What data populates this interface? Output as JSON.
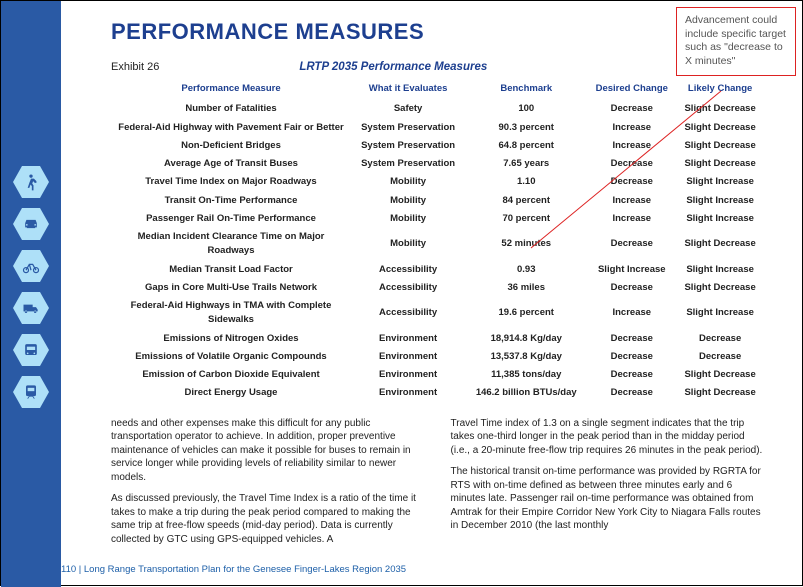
{
  "page_title": "PERFORMANCE MEASURES",
  "exhibit_label": "Exhibit 26",
  "exhibit_title": "LRTP 2035 Performance Measures",
  "columns": {
    "c0": "Performance Measure",
    "c1": "What it Evaluates",
    "c2": "Benchmark",
    "c3": "Desired Change",
    "c4": "Likely Change"
  },
  "rows": [
    {
      "m": "Number of Fatalities",
      "e": "Safety",
      "b": "100",
      "d": "Decrease",
      "l": "Slight Decrease"
    },
    {
      "m": "Federal-Aid Highway with Pavement Fair or Better",
      "e": "System Preservation",
      "b": "90.3 percent",
      "d": "Increase",
      "l": "Slight Decrease"
    },
    {
      "m": "Non-Deficient Bridges",
      "e": "System Preservation",
      "b": "64.8 percent",
      "d": "Increase",
      "l": "Slight Decrease"
    },
    {
      "m": "Average Age of Transit Buses",
      "e": "System Preservation",
      "b": "7.65 years",
      "d": "Decrease",
      "l": "Slight Decrease"
    },
    {
      "m": "Travel Time Index on Major Roadways",
      "e": "Mobility",
      "b": "1.10",
      "d": "Decrease",
      "l": "Slight Increase"
    },
    {
      "m": "Transit On-Time Performance",
      "e": "Mobility",
      "b": "84 percent",
      "d": "Increase",
      "l": "Slight Increase"
    },
    {
      "m": "Passenger Rail On-Time Performance",
      "e": "Mobility",
      "b": "70 percent",
      "d": "Increase",
      "l": "Slight Increase"
    },
    {
      "m": "Median Incident Clearance Time on Major Roadways",
      "e": "Mobility",
      "b": "52 minutes",
      "d": "Decrease",
      "l": "Slight Decrease"
    },
    {
      "m": "Median Transit Load Factor",
      "e": "Accessibility",
      "b": "0.93",
      "d": "Slight Increase",
      "l": "Slight Increase"
    },
    {
      "m": "Gaps in Core Multi-Use Trails Network",
      "e": "Accessibility",
      "b": "36 miles",
      "d": "Decrease",
      "l": "Slight Decrease"
    },
    {
      "m": "Federal-Aid Highways in TMA with Complete Sidewalks",
      "e": "Accessibility",
      "b": "19.6 percent",
      "d": "Increase",
      "l": "Slight Increase"
    },
    {
      "m": "Emissions of Nitrogen Oxides",
      "e": "Environment",
      "b": "18,914.8 Kg/day",
      "d": "Decrease",
      "l": "Decrease"
    },
    {
      "m": "Emissions of Volatile Organic Compounds",
      "e": "Environment",
      "b": "13,537.8 Kg/day",
      "d": "Decrease",
      "l": "Decrease"
    },
    {
      "m": "Emission of Carbon Dioxide Equivalent",
      "e": "Environment",
      "b": "11,385 tons/day",
      "d": "Decrease",
      "l": "Slight Decrease"
    },
    {
      "m": "Direct Energy Usage",
      "e": "Environment",
      "b": "146.2 billion BTUs/day",
      "d": "Decrease",
      "l": "Slight Decrease"
    }
  ],
  "body": {
    "left_p1": "needs and other expenses make this difficult for any public transportation operator to achieve. In addition, proper preventive maintenance of vehicles can make it possible for buses to remain in service longer while providing levels of reliability similar to newer models.",
    "left_p2": "As discussed previously, the Travel Time Index is a ratio of the time it takes to make a trip during the peak period compared to making the same trip at free-flow speeds (mid-day period). Data is currently collected by GTC using GPS-equipped vehicles. A",
    "right_p1": "Travel Time index of 1.3 on a single segment indicates that the trip takes one-third longer in the peak period than in the midday period (i.e., a 20-minute free-flow trip requires 26 minutes in the peak period).",
    "right_p2": "The historical transit on-time performance was provided by RGRTA for RTS with on-time defined as between three minutes early and 6 minutes late. Passenger rail on-time performance was obtained from Amtrak for their Empire Corridor New York City to Niagara Falls routes in December 2010 (the last monthly"
  },
  "footer": "110 | Long Range Transportation Plan for the Genesee Finger-Lakes Region 2035",
  "annotation_text": "Advancement could include specific target such as \"decrease to X minutes\"",
  "sidebar_icons": [
    "pedestrian-icon",
    "car-icon",
    "bicycle-icon",
    "truck-icon",
    "bus-icon",
    "train-icon"
  ]
}
